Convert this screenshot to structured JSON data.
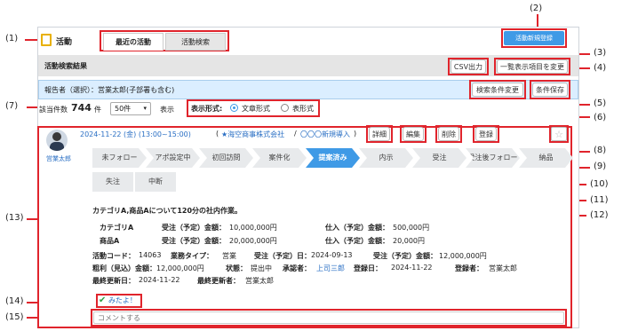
{
  "callouts": [
    "(1)",
    "(2)",
    "(3)",
    "(4)",
    "(5)",
    "(6)",
    "(7)",
    "(8)",
    "(9)",
    "(10)",
    "(11)",
    "(12)",
    "(13)",
    "(14)",
    "(15)"
  ],
  "header": {
    "title": "活動",
    "tab_recent": "最近の活動",
    "tab_search": "活動検索",
    "new_button": "活動新規登録"
  },
  "results_bar": {
    "title": "活動検索結果",
    "csv_button": "CSV出力",
    "columns_button": "一覧表示項目を変更"
  },
  "reporter_bar": {
    "text": "報告者（選択）：営業太郎(子部署も含む)",
    "change_button": "検索条件変更",
    "save_button": "条件保存"
  },
  "list_controls": {
    "count_label": "該当件数",
    "count_value": "744",
    "count_unit": "件",
    "per_page": "50件",
    "display_label": "表示",
    "format_label": "表示形式:",
    "format_text": "文章形式",
    "format_table": "表形式"
  },
  "activity": {
    "user_name": "営業太郎",
    "date": "2024-11-22 (金) (13:00~15:00)",
    "paren_open": "(",
    "company": "★海空商事株式会社",
    "slash": "/",
    "deal": "〇〇〇新規導入",
    "paren_close": ")",
    "detail_button": "詳細",
    "edit_button": "編集",
    "delete_button": "削除",
    "register_button": "登録",
    "stages_row1": [
      "未フォロー",
      "アポ設定中",
      "初回訪問",
      "案件化",
      "提案済み",
      "内示",
      "受注",
      "受注後フォロー",
      "納品"
    ],
    "stages_row2": [
      "失注",
      "中断"
    ],
    "active_stage": "提案済み",
    "summary": "カテゴリA,商品Aについて120分の社内作業。",
    "items": [
      {
        "name": "カテゴリA",
        "order_label": "受注（予定）金額：",
        "order_value": "10,000,000円",
        "cost_label": "仕入（予定）金額：",
        "cost_value": "500,000円"
      },
      {
        "name": "商品A",
        "order_label": "受注（予定）金額：",
        "order_value": "20,000,000円",
        "cost_label": "仕入（予定）金額：",
        "cost_value": "20,000円"
      }
    ],
    "meta": {
      "code_label": "活動コード：",
      "code": "14063",
      "type_label": "業務タイプ：",
      "type": "営業",
      "order_date_label": "受注（予定）日：",
      "order_date": "2024-09-13",
      "order_amount_label": "受注（予定）金額：",
      "order_amount": "12,000,000円",
      "gross_label": "粗利（見込）金額：",
      "gross": "12,000,000円",
      "status_label": "状態：",
      "status": "提出中",
      "approver_label": "承認者：",
      "approver": "上司三郎",
      "reg_date_label": "登録日：",
      "reg_date": "2024-11-22",
      "registrant_label": "登録者：",
      "registrant": "営業太郎",
      "updated_label": "最終更新日：",
      "updated": "2024-11-22",
      "updater_label": "最終更新者：",
      "updater": "営業太郎"
    },
    "mitayo": "みたよ！",
    "comment_placeholder": "コメントする"
  },
  "colors": {
    "accent": "#3f9ae6",
    "callout": "#e0242c",
    "link": "#2a6fc4"
  }
}
